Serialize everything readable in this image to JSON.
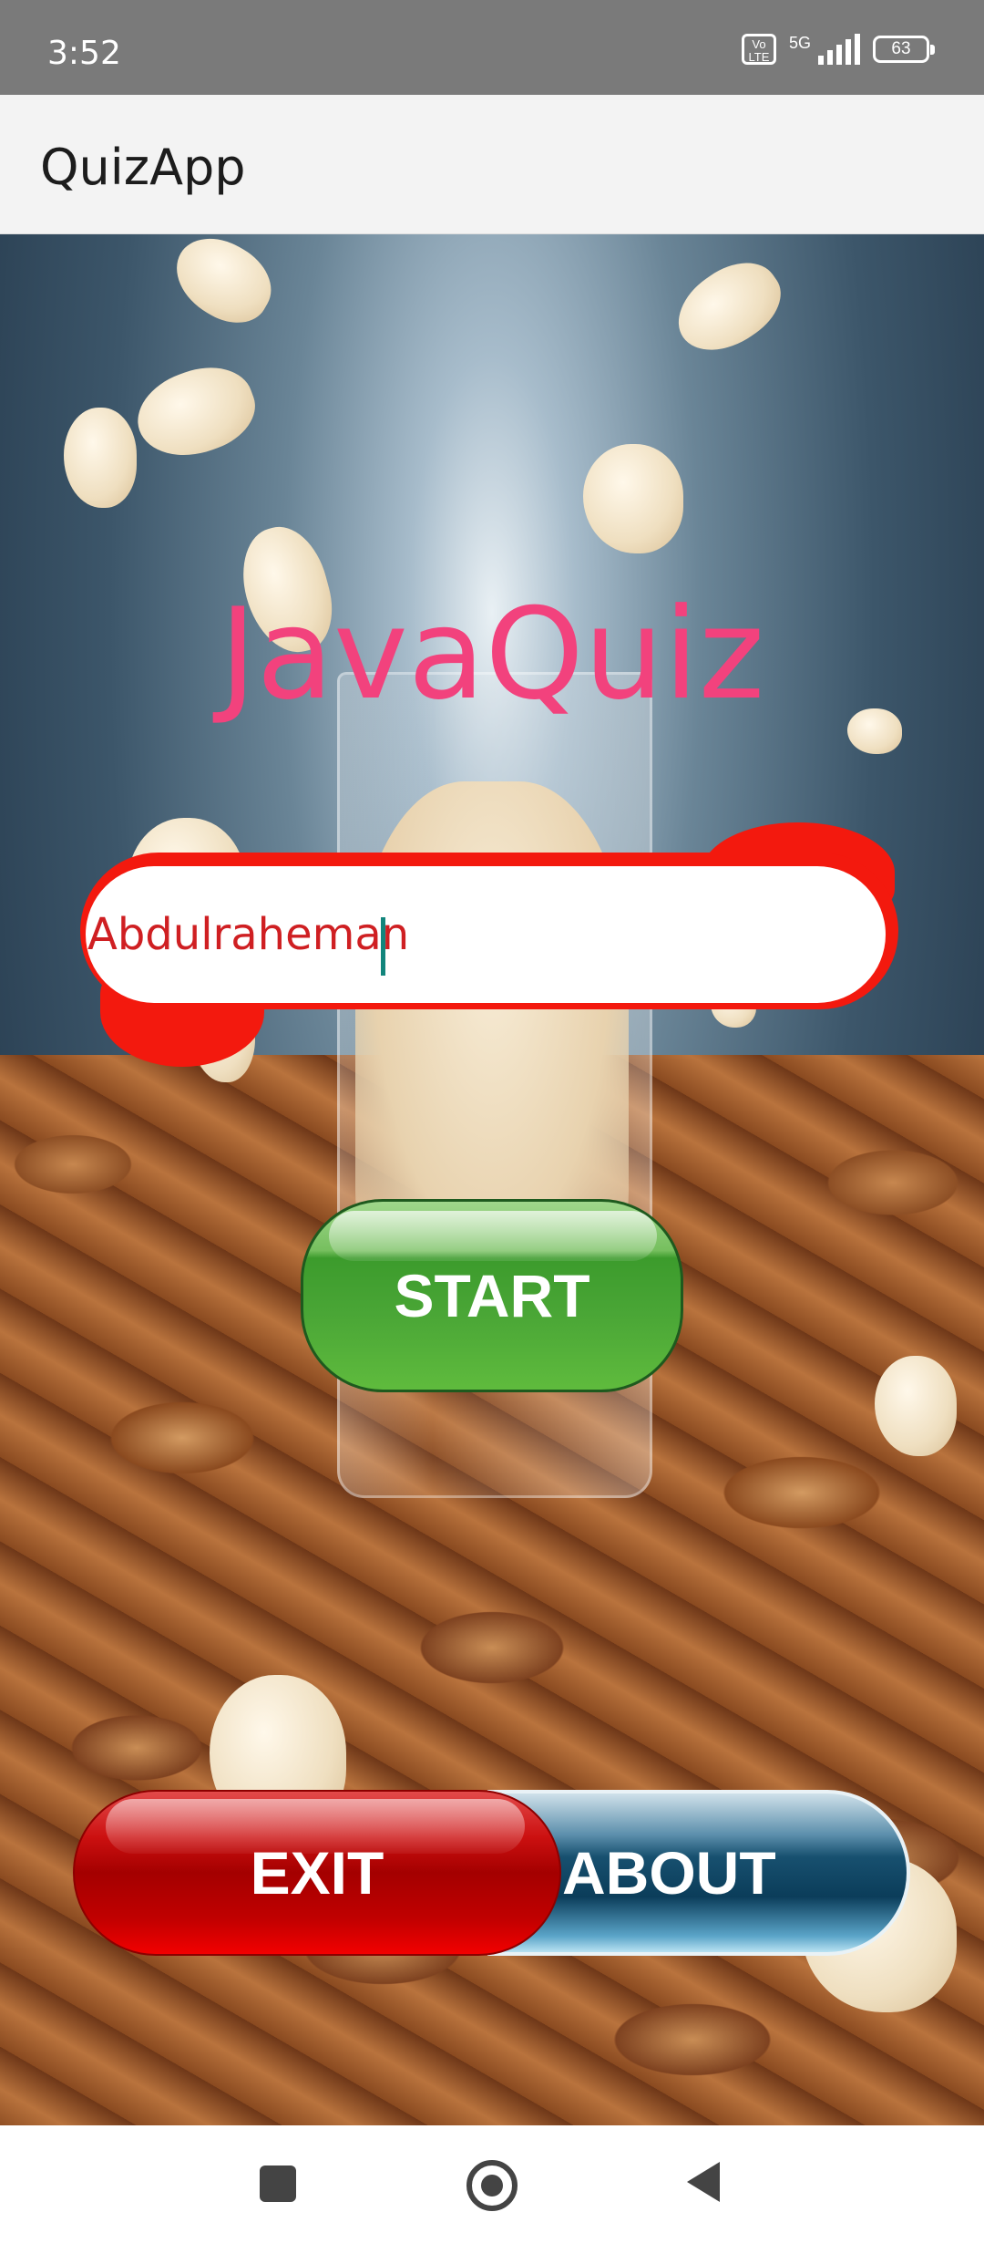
{
  "status_bar": {
    "time": "3:52",
    "volte_label": "Vo LTE",
    "network_label": "5G",
    "battery_level": "63"
  },
  "app_bar": {
    "title": "QuizApp"
  },
  "main": {
    "heading": "JavaQuiz",
    "name_input": {
      "value": "Abdulraheman"
    },
    "start_label": "START",
    "exit_label": "EXIT",
    "about_label": "ABOUT"
  },
  "nav_bar": {
    "recents_icon": "square-recents-icon",
    "home_icon": "circle-home-icon",
    "back_icon": "triangle-back-icon"
  },
  "colors": {
    "heading": "#f2427d",
    "input_border": "#f3190e",
    "input_text": "#cf1f22",
    "start_button": "#4aa636",
    "exit_button": "#c00000",
    "about_button": "#17506f"
  }
}
